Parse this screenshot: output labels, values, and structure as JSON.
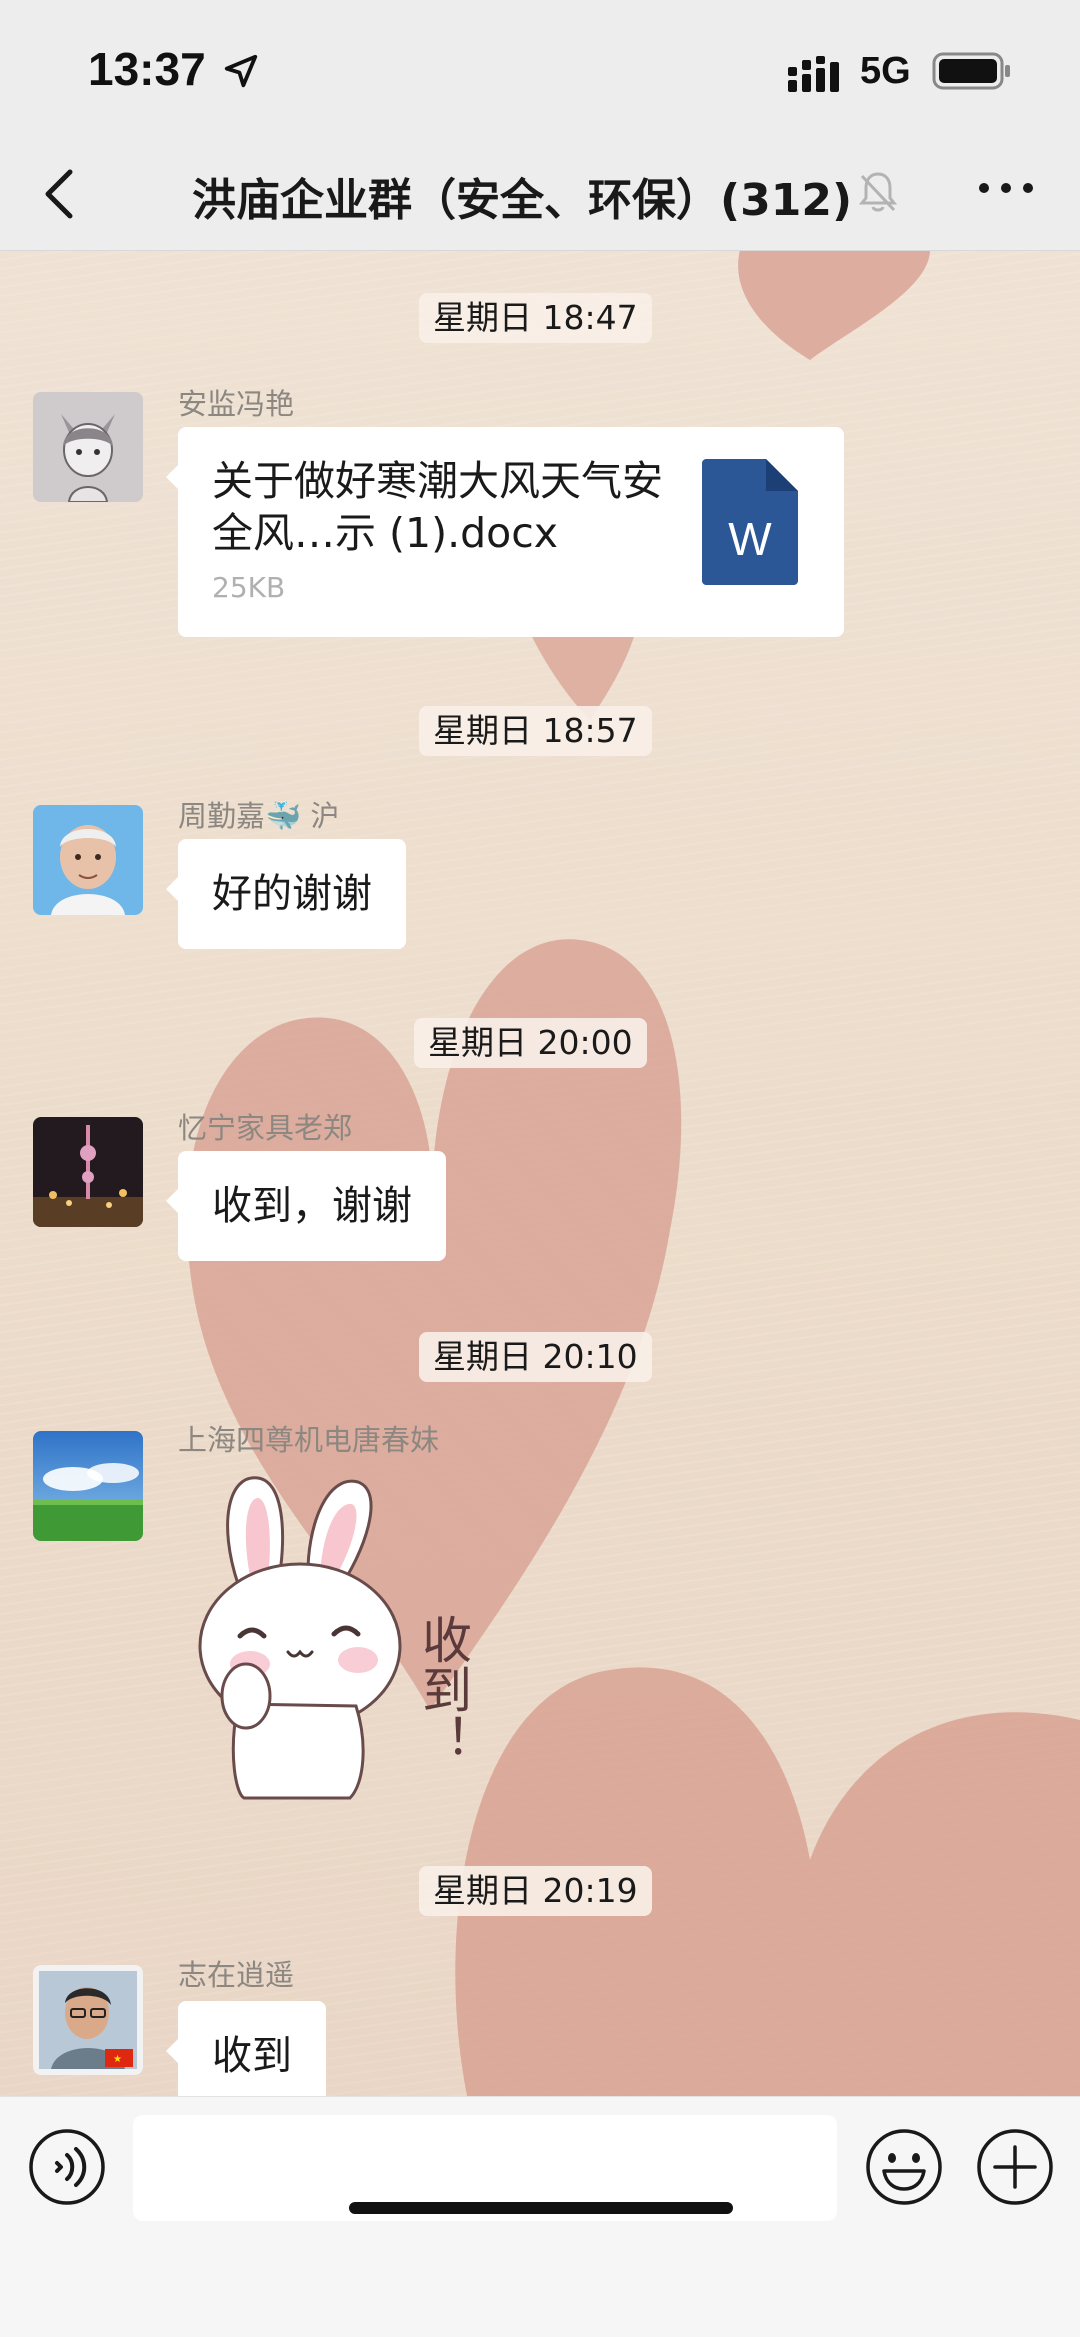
{
  "status_bar": {
    "time": "13:37",
    "network": "5G"
  },
  "nav": {
    "title": "洪庙企业群（安全、环保）(312)"
  },
  "messages": [
    {
      "timestamp": "星期日 18:47",
      "sender": "安监冯艳",
      "type": "file",
      "file_name": "关于做好寒潮大风天气安全风…示 (1).docx",
      "file_size": "25KB",
      "file_icon_letter": "W"
    },
    {
      "timestamp": "星期日 18:57",
      "sender": "周勤嘉🐳 沪",
      "type": "text",
      "text": "好的谢谢"
    },
    {
      "timestamp": "星期日 20:00",
      "sender": "忆宁家具老郑",
      "type": "text",
      "text": "收到，谢谢"
    },
    {
      "timestamp": "星期日 20:10",
      "sender": "上海四尊机电唐春妹",
      "type": "sticker",
      "sticker_text": "收到！"
    },
    {
      "timestamp": "星期日 20:19",
      "sender": "志在逍遥",
      "type": "text",
      "text": "收到"
    }
  ],
  "input_bar": {
    "value": ""
  },
  "colors": {
    "header_bg": "#ededed",
    "wallpaper_bg": "#efe2d4",
    "heart": "#d9a596",
    "bubble_bg": "#ffffff",
    "word_blue": "#2b5797"
  }
}
